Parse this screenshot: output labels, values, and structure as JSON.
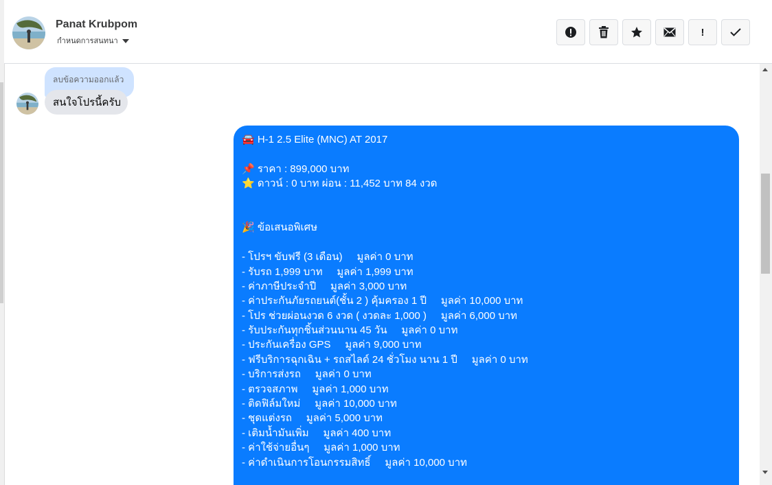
{
  "header": {
    "name": "Panat Krubpom",
    "status_label": "กำหนดการสนทนา"
  },
  "actions": [
    {
      "name": "report-icon",
      "glyph": "!"
    },
    {
      "name": "trash-icon"
    },
    {
      "name": "star-icon"
    },
    {
      "name": "mail-icon"
    },
    {
      "name": "exclamation-icon",
      "glyph": "!"
    },
    {
      "name": "check-icon"
    }
  ],
  "thread": {
    "deleted_notice": "ลบข้อความออกแล้ว",
    "incoming_message": "สนใจโปรนี้ครับ",
    "outgoing_lines": [
      "🚘 H-1 2.5 Elite (MNC) AT 2017",
      "",
      "📌 ราคา : 899,000 บาท",
      "⭐ ดาวน์ : 0 บาท ผ่อน : 11,452 บาท 84 งวด",
      "",
      "",
      "🎉 ข้อเสนอพิเศษ",
      "",
      "- โปรฯ ขับฟรี (3 เดือน)     มูลค่า 0 บาท",
      "- รับรถ 1,999 บาท     มูลค่า 1,999 บาท",
      "- ค่าภาษีประจำปี     มูลค่า 3,000 บาท",
      "- ค่าประกันภัยรถยนต์(ชั้น 2 ) คุ้มครอง 1 ปี     มูลค่า 10,000 บาท",
      "- โปร ช่วยผ่อนงวด 6 งวด ( งวดละ 1,000 )     มูลค่า 6,000 บาท",
      "- รับประกันทุกชิ้นส่วนนาน 45 วัน     มูลค่า 0 บาท",
      "- ประกันเครื่อง GPS     มูลค่า 9,000 บาท",
      "- ฟรีบริการฉุกเฉิน + รถสไลด์ 24 ชั่วโมง นาน 1 ปี     มูลค่า 0 บาท",
      "- บริการส่งรถ     มูลค่า 0 บาท",
      "- ตรวจสภาพ     มูลค่า 1,000 บาท",
      "- ติดฟิล์มใหม่     มูลค่า 10,000 บาท",
      "- ชุดแต่งรถ     มูลค่า 5,000 บาท",
      "- เติมน้ำมันเพิ่ม     มูลค่า 400 บาท",
      "- ค่าใช้จ่ายอื่นๆ     มูลค่า 1,000 บาท",
      "- ค่าดำเนินการโอนกรรมสิทธิ์     มูลค่า 10,000 บาท"
    ]
  },
  "colors": {
    "outgoing_bubble": "#0a7cff",
    "incoming_bubble": "#e4e6eb",
    "deleted_bubble": "#cfe3ff"
  }
}
